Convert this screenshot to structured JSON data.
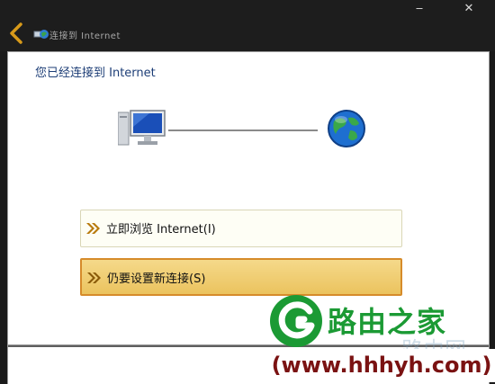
{
  "window": {
    "title": "连接到 Internet",
    "minimize_glyph": "‒",
    "close_glyph": "✕"
  },
  "content": {
    "heading": "您已经连接到 Internet"
  },
  "options": [
    {
      "label": "立即浏览 Internet(I)",
      "icon": "double-chevron-right-icon"
    },
    {
      "label": "仍要设置新连接(S)",
      "icon": "double-chevron-right-icon"
    }
  ],
  "icons": {
    "back": "back-arrow-icon",
    "network": "network-icon",
    "computer": "computer-icon",
    "globe": "globe-icon"
  },
  "watermark": {
    "brand": "路由之家",
    "brand_ghost": "路由网",
    "url": "(www.hhhyh.com)"
  },
  "colors": {
    "selected_fill": "#ebc35e",
    "selected_border": "#d68b2a",
    "heading_text": "#1c3d76",
    "watermark_green": "#1b9a34",
    "watermark_url": "#7a1212"
  }
}
